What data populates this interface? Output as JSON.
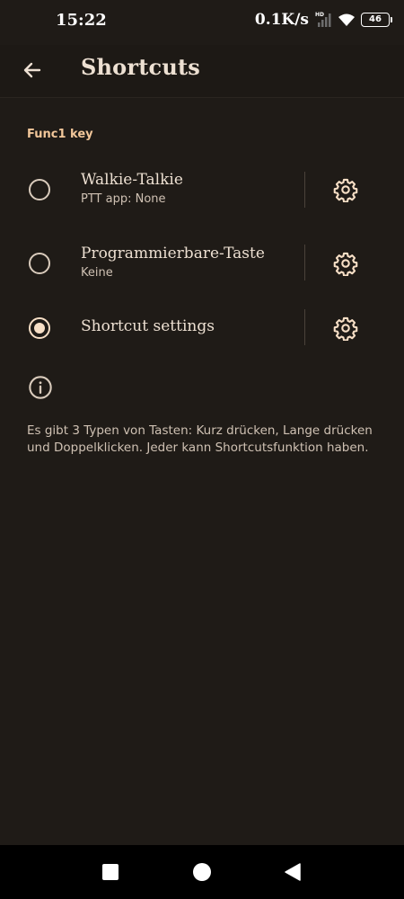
{
  "status_bar": {
    "time": "15:22",
    "net_speed": "0.1K/s",
    "network_badge": "HD",
    "battery": "46",
    "icons": [
      "signal-icon",
      "wifi-icon",
      "battery-icon"
    ]
  },
  "app_bar": {
    "title": "Shortcuts",
    "back_icon": "arrow-left-icon"
  },
  "section": {
    "header": "Func1 key"
  },
  "options": [
    {
      "title": "Walkie-Talkie",
      "subtitle": "PTT app: None",
      "selected": false,
      "settings_icon": "gear-icon"
    },
    {
      "title": "Programmierbare-Taste",
      "subtitle": "Keine",
      "selected": false,
      "settings_icon": "gear-icon"
    },
    {
      "title": "Shortcut settings",
      "subtitle": "",
      "selected": true,
      "settings_icon": "gear-icon"
    }
  ],
  "info": {
    "icon": "info-icon",
    "text": "Es gibt 3 Typen von Tasten: Kurz drücken, Lange drücken und Doppelklicken. Jeder kann Shortcutsfunktion haben."
  },
  "nav_bar": {
    "icons": [
      "recents-icon",
      "home-icon",
      "back-icon"
    ]
  },
  "colors": {
    "background": "#1f1b17",
    "accent": "#f2c79a",
    "text": "#ede0d2",
    "nav_background": "#000000"
  }
}
